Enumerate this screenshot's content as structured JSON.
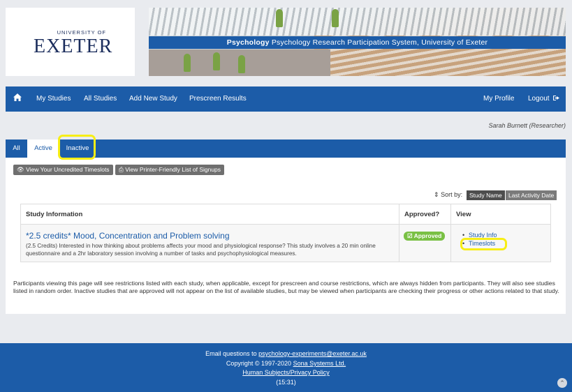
{
  "logo": {
    "top_line": "UNIVERSITY OF",
    "name": "EXETER"
  },
  "banner": {
    "bold": "Psychology",
    "rest": "Psychology Research Participation System, University of Exeter"
  },
  "nav": {
    "home_icon": "home-icon",
    "my_studies": "My Studies",
    "all_studies": "All Studies",
    "add_new_study": "Add New Study",
    "prescreen_results": "Prescreen Results",
    "my_profile": "My Profile",
    "logout": "Logout",
    "logout_icon": "sign-out-icon"
  },
  "user": "Sarah Burnett (Researcher)",
  "tabs": [
    {
      "label": "All"
    },
    {
      "label": "Active"
    },
    {
      "label": "Inactive"
    }
  ],
  "buttons": {
    "uncredited": "View Your Uncredited Timeslots",
    "printer": "View Printer-Friendly List of Signups"
  },
  "sort": {
    "label": "Sort by:",
    "study_name": "Study Name",
    "last_activity": "Last Activity Date"
  },
  "table": {
    "headers": [
      "Study Information",
      "Approved?",
      "View"
    ],
    "rows": [
      {
        "title": "*2.5 credits* Mood, Concentration and Problem solving",
        "description": "(2.5 Credits) Interested in how thinking about problems affects your mood and physiological response? This study involves a 20 min online questionnaire and a 2hr laboratory session involving a number of tasks and psychophysiological measures.",
        "approved": "Approved",
        "view_links": [
          "Study Info",
          "Timeslots"
        ]
      }
    ]
  },
  "note": "Participants viewing this page will see restrictions listed with each study, when applicable, except for prescreen and course restrictions, which are always hidden from participants. They will also see studies listed in random order.  Inactive studies that are approved will not appear on the list of available studies, but may be viewed when participants are checking their progress or other actions related to that study.",
  "footer": {
    "email_prefix": "Email questions to",
    "email": "psychology-experiments@exeter.ac.uk",
    "copyright_prefix": "Copyright © 1997-2020",
    "copyright_link": "Sona Systems Ltd.",
    "privacy": "Human Subjects/Privacy Policy",
    "time": "(15:31)"
  },
  "colors": {
    "primary": "#1c5ca8",
    "approved": "#79c044",
    "highlight": "#f7ee16"
  }
}
